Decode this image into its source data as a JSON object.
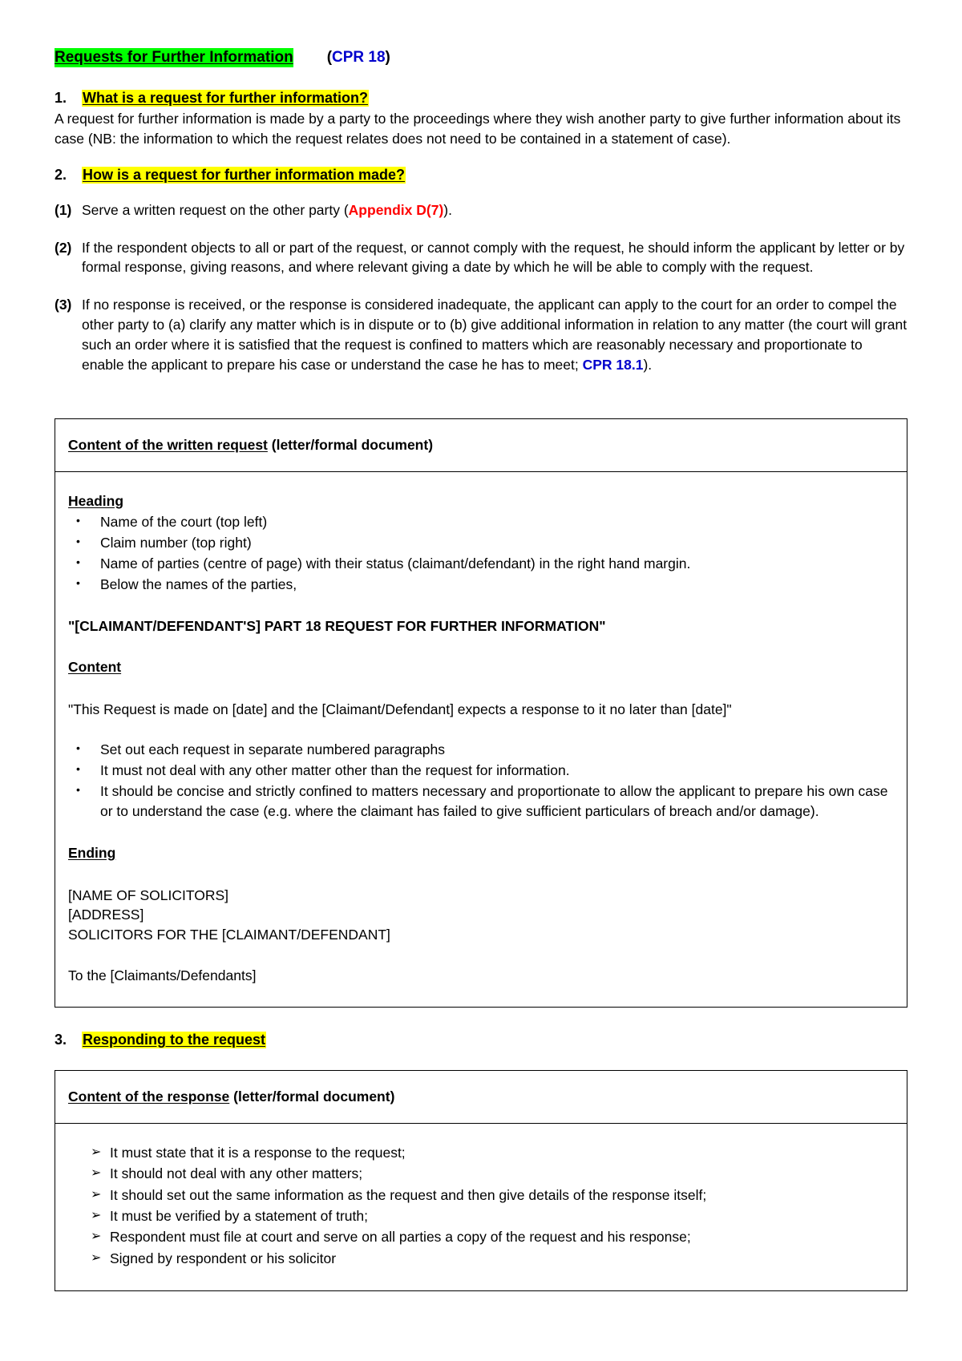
{
  "document": {
    "title": {
      "main": "Requests for Further Information",
      "reference_open": "(",
      "reference": "CPR 18",
      "reference_close": ")"
    },
    "sections": [
      {
        "number": "1.",
        "heading": "What is a request for further information?",
        "paragraph": "A request for further information is made by a party to the proceedings where they wish another party to give further information about its case (NB: the information to which the request relates does not need to be contained in a statement of case)."
      },
      {
        "number": "2.",
        "heading": "How is a request for further information made?",
        "items": [
          {
            "marker": "(1)",
            "text_before": "Serve a written request on the other party (",
            "emphasis": "Appendix D(7)",
            "text_after": ")."
          },
          {
            "marker": "(2)",
            "text_before": "If the respondent objects to all or part of the request, or cannot comply with the request, he should inform the applicant by letter or by formal response, giving reasons, and where relevant giving a date by which he will be able to comply with the request.",
            "emphasis": "",
            "text_after": ""
          },
          {
            "marker": "(3)",
            "text_before": "If no response is received, or the response is considered inadequate, the applicant can apply to the court for an order to compel the other party to (a) clarify any matter which is in dispute or to (b) give additional information in relation to any matter (the court will grant such an order where it is satisfied that the request is confined to matters which are reasonably necessary and proportionate to enable the applicant to prepare his case or understand the case he has to meet; ",
            "emphasis": "CPR 18.1",
            "text_after": ")."
          }
        ]
      },
      {
        "number": "3.",
        "heading": "Responding to the request"
      }
    ],
    "box_request": {
      "header_underlined": "Content of the written request",
      "header_plain": " (letter/formal document)",
      "heading_label": "Heading",
      "heading_bullets": [
        "Name of the court (top left)",
        "Claim number (top right)",
        "Name of parties (centre of page) with their status (claimant/defendant) in the right hand margin.",
        "Below the names of the parties,"
      ],
      "title_line": "\"[CLAIMANT/DEFENDANT'S] PART 18 REQUEST FOR FURTHER INFORMATION\"",
      "content_label": "Content",
      "content_quote": "\"This Request is made on [date] and the [Claimant/Defendant] expects a response to it no later than [date]\"",
      "content_bullets": [
        "Set out each request in separate numbered paragraphs",
        "It must not deal with any other matter other than the request for information.",
        "It should be concise and strictly confined to matters necessary and proportionate to allow the applicant to prepare his own case or to understand the case (e.g. where the claimant has failed to give sufficient particulars of breach and/or damage)."
      ],
      "ending_label": "Ending",
      "ending_lines": [
        "[NAME OF SOLICITORS]",
        "[ADDRESS]",
        "SOLICITORS FOR THE [CLAIMANT/DEFENDANT]"
      ],
      "ending_to_line": "To the [Claimants/Defendants]"
    },
    "box_response": {
      "header_underlined": "Content of the response",
      "header_plain": " (letter/formal document)",
      "bullets": [
        "It must state that it is a response to the request;",
        "It should not deal with any other matters;",
        "It should set out the same information as the request and then give details of the response itself;",
        "It must be verified by a statement of truth;",
        "Respondent must file at court and serve on all parties a copy of the request and his response;",
        "Signed by respondent or his solicitor"
      ]
    },
    "glyphs": {
      "bullet": "•",
      "arrow_bullet": "➢"
    },
    "colors": {
      "title_highlight": "#00ff00",
      "heading_highlight": "#ffff00",
      "reference_blue": "#0000cc",
      "emphasis_red": "#ff0000",
      "text": "#000000",
      "page_background": "#ffffff"
    }
  }
}
